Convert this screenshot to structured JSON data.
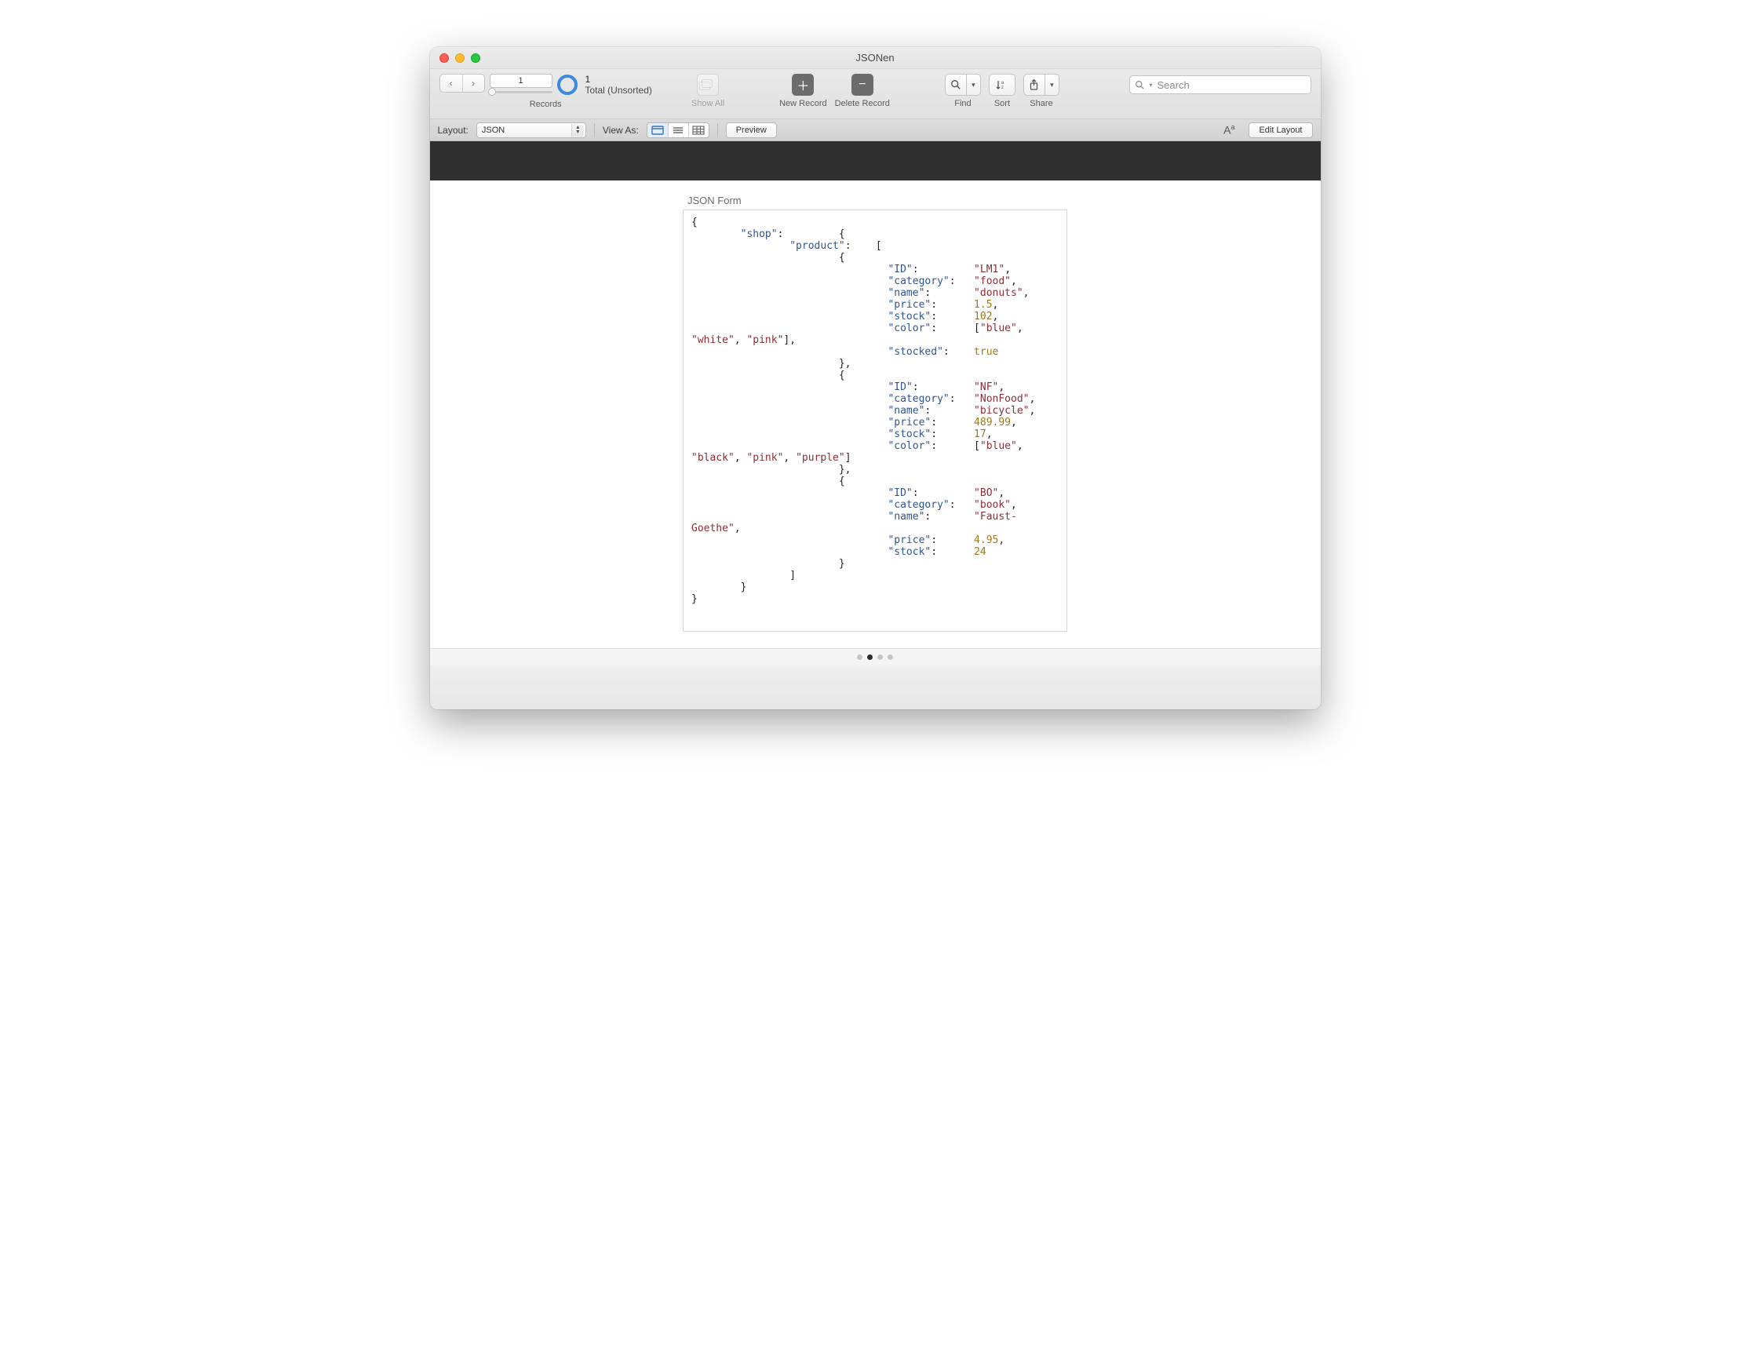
{
  "window": {
    "title": "JSONen"
  },
  "toolbar": {
    "record_number": "1",
    "records_count": "1",
    "records_status": "Total (Unsorted)",
    "records_label": "Records",
    "show_all_label": "Show All",
    "new_record_label": "New Record",
    "delete_record_label": "Delete Record",
    "find_label": "Find",
    "sort_label": "Sort",
    "share_label": "Share",
    "search_placeholder": "Search"
  },
  "subbar": {
    "layout_label": "Layout:",
    "layout_value": "JSON",
    "view_as_label": "View As:",
    "preview_label": "Preview",
    "edit_layout_label": "Edit Layout"
  },
  "content": {
    "form_title": "JSON Form",
    "json": {
      "shop": {
        "product": [
          {
            "ID": "LM1",
            "category": "food",
            "name": "donuts",
            "price": 1.5,
            "stock": 102,
            "color": [
              "blue",
              "white",
              "pink"
            ],
            "stocked": true
          },
          {
            "ID": "NF",
            "category": "NonFood",
            "name": "bicycle",
            "price": 489.99,
            "stock": 17,
            "color": [
              "blue",
              "black",
              "pink",
              "purple"
            ]
          },
          {
            "ID": "BO",
            "category": "book",
            "name": "Faust- Goethe",
            "price": 4.95,
            "stock": 24
          }
        ]
      }
    }
  },
  "pager": {
    "count": 4,
    "active_index": 1
  }
}
